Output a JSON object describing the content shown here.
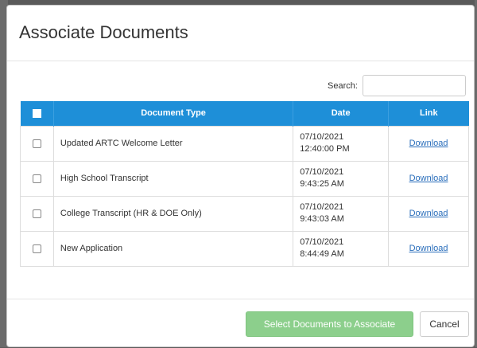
{
  "modal": {
    "title": "Associate Documents"
  },
  "search": {
    "label": "Search:",
    "value": "",
    "placeholder": ""
  },
  "table": {
    "headers": {
      "document_type": "Document Type",
      "date": "Date",
      "link": "Link"
    },
    "rows": [
      {
        "document_type": "Updated ARTC Welcome Letter",
        "date_line1": "07/10/2021",
        "date_line2": "12:40:00 PM",
        "link": "Download",
        "checked": false
      },
      {
        "document_type": "High School Transcript",
        "date_line1": "07/10/2021",
        "date_line2": "9:43:25 AM",
        "link": "Download",
        "checked": false
      },
      {
        "document_type": "College Transcript (HR & DOE Only)",
        "date_line1": "07/10/2021",
        "date_line2": "9:43:03 AM",
        "link": "Download",
        "checked": false
      },
      {
        "document_type": "New Application",
        "date_line1": "07/10/2021",
        "date_line2": "8:44:49 AM",
        "link": "Download",
        "checked": false
      }
    ]
  },
  "footer": {
    "associate_label": "Select Documents to Associate",
    "cancel_label": "Cancel"
  },
  "colors": {
    "header_bg": "#1e8fd8",
    "associate_button": "#8ccf8c",
    "link": "#2a6ebb"
  }
}
